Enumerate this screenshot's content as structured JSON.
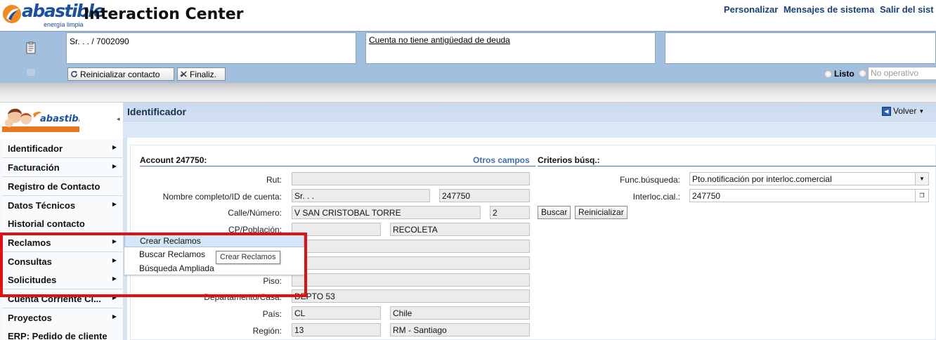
{
  "header": {
    "logo_text": "abastible",
    "logo_tagline": "energía limpia",
    "app_title": "Interaction Center",
    "links": [
      "Personalizar",
      "Mensajes de sistema",
      "Salir del sist"
    ]
  },
  "context": {
    "customer": "Sr. . . / 7002090",
    "debt_message": "Cuenta no tiene antigüedad de deuda ",
    "buttons": {
      "reset_contact": "Reinicializar contacto",
      "finalize": "Finaliz."
    },
    "status": {
      "ready": "Listo",
      "not_operational": "No operativo"
    }
  },
  "nav": {
    "logo_text": "abastible",
    "items": [
      {
        "label": "Identificador",
        "has_submenu": true
      },
      {
        "label": "Facturación",
        "has_submenu": true
      },
      {
        "label": "Registro de Contacto",
        "has_submenu": false
      },
      {
        "label": "Datos Técnicos",
        "has_submenu": true
      },
      {
        "label": "Historial contacto",
        "has_submenu": false
      },
      {
        "label": "Reclamos",
        "has_submenu": true
      },
      {
        "label": "Consultas",
        "has_submenu": true
      },
      {
        "label": "Solicitudes",
        "has_submenu": true
      },
      {
        "label": "Cuenta Corriente Cl...",
        "has_submenu": true
      },
      {
        "label": "Proyectos",
        "has_submenu": true
      },
      {
        "label": "ERP: Pedido de cliente",
        "has_submenu": false
      }
    ]
  },
  "flyout": {
    "items": [
      "Crear Reclamos",
      "Buscar Reclamos",
      "Búsqueda Ampliada"
    ],
    "tooltip": "Crear Reclamos"
  },
  "main": {
    "title": "Identificador",
    "back_label": "Volver",
    "account_title": "Account 247750:",
    "other_fields_link": "Otros campos",
    "criteria_title": "Criterios búsq.:",
    "fields": {
      "rut_label": "Rut:",
      "rut_value": "",
      "name_label": "Nombre completo/ID de cuenta:",
      "name_value": "Sr. . .",
      "account_id": "247750",
      "street_label": "Calle/Número:",
      "street_value": "V SAN CRISTOBAL TORRE",
      "street_number": "2",
      "city_label": "CP/Población:",
      "postal_code": "",
      "city_value": "RECOLETA",
      "floor_label": "Piso:",
      "floor_value": "",
      "apartment_label": "Departamento/Casa:",
      "apartment_value": "DEPTO 53",
      "country_label": "País:",
      "country_code": "CL",
      "country_name": "Chile",
      "region_label": "Región:",
      "region_code": "13",
      "region_name": "RM - Santiago"
    },
    "criteria": {
      "search_func_label": "Func.búsqueda:",
      "search_func_value": "Pto.notificación por interloc.comercial",
      "partner_label": "Interloc.cial.:",
      "partner_value": "247750"
    },
    "buttons": {
      "search": "Buscar",
      "reset": "Reinicializar"
    }
  }
}
